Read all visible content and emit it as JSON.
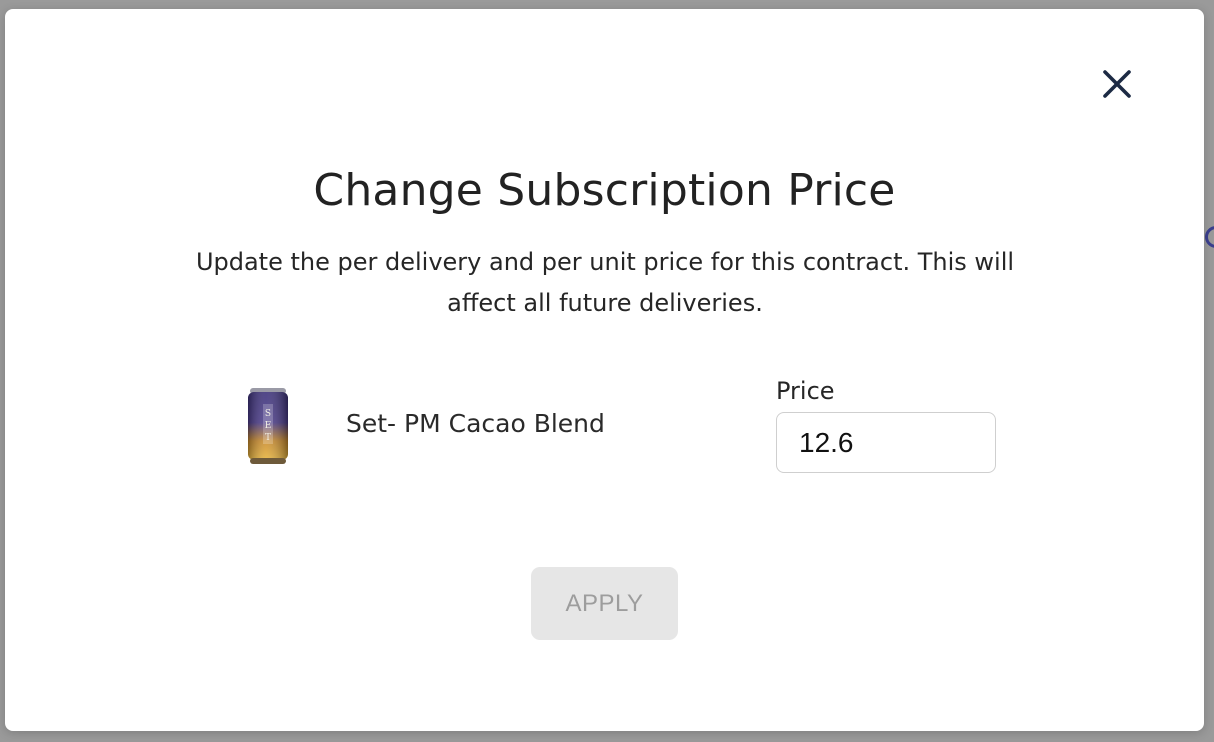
{
  "modal": {
    "title": "Change Subscription Price",
    "description": "Update the per delivery and per unit price for this contract. This will affect all future deliveries.",
    "close_icon": "close-icon"
  },
  "product": {
    "name": "Set- PM Cacao Blend",
    "image_icon": "product-can-image",
    "can_label": "SET"
  },
  "price": {
    "label": "Price",
    "value": "12.6"
  },
  "actions": {
    "apply_label": "APPLY",
    "apply_disabled": true
  },
  "colors": {
    "close_icon": "#1c2a44",
    "apply_bg": "#e6e6e6",
    "apply_text": "#9d9d9d"
  }
}
